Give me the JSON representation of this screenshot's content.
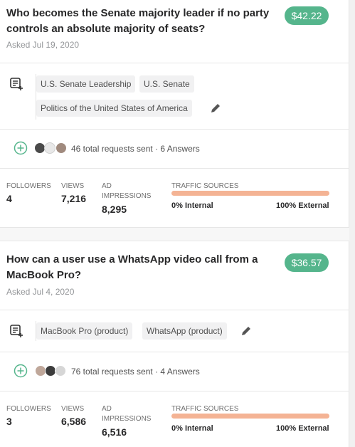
{
  "questions": [
    {
      "title": "Who becomes the Senate majority leader if no party controls an absolute majority of seats?",
      "price": "$42.22",
      "asked": "Asked Jul 19, 2020",
      "tags": [
        "U.S. Senate Leadership",
        "U.S. Senate",
        "Politics of the United States of America"
      ],
      "requests": "46 total requests sent · 6 Answers",
      "stats": {
        "followers_label": "FOLLOWERS",
        "followers": "4",
        "views_label": "VIEWS",
        "views": "7,216",
        "ad_label": "AD IMPRESSIONS",
        "ad": "8,295",
        "traffic_label": "TRAFFIC SOURCES",
        "internal": "0% Internal",
        "external": "100% External",
        "internal_fraction": 0.0
      }
    },
    {
      "title": "How can a user use a WhatsApp video call from a MacBook Pro?",
      "price": "$36.57",
      "asked": "Asked Jul 4, 2020",
      "tags": [
        "MacBook Pro (product)",
        "WhatsApp (product)"
      ],
      "requests": "76 total requests sent · 4 Answers",
      "stats": {
        "followers_label": "FOLLOWERS",
        "followers": "3",
        "views_label": "VIEWS",
        "views": "6,586",
        "ad_label": "AD IMPRESSIONS",
        "ad": "6,516",
        "traffic_label": "TRAFFIC SOURCES",
        "internal": "0% Internal",
        "external": "100% External",
        "internal_fraction": 0.0
      }
    }
  ],
  "colors": {
    "price_badge": "#55b58c",
    "traffic_bar": "#f4b394",
    "add_icon": "#55b58c"
  },
  "icons": {
    "topic": "topic-list-icon",
    "edit": "pencil-icon",
    "add": "add-circle-icon"
  }
}
